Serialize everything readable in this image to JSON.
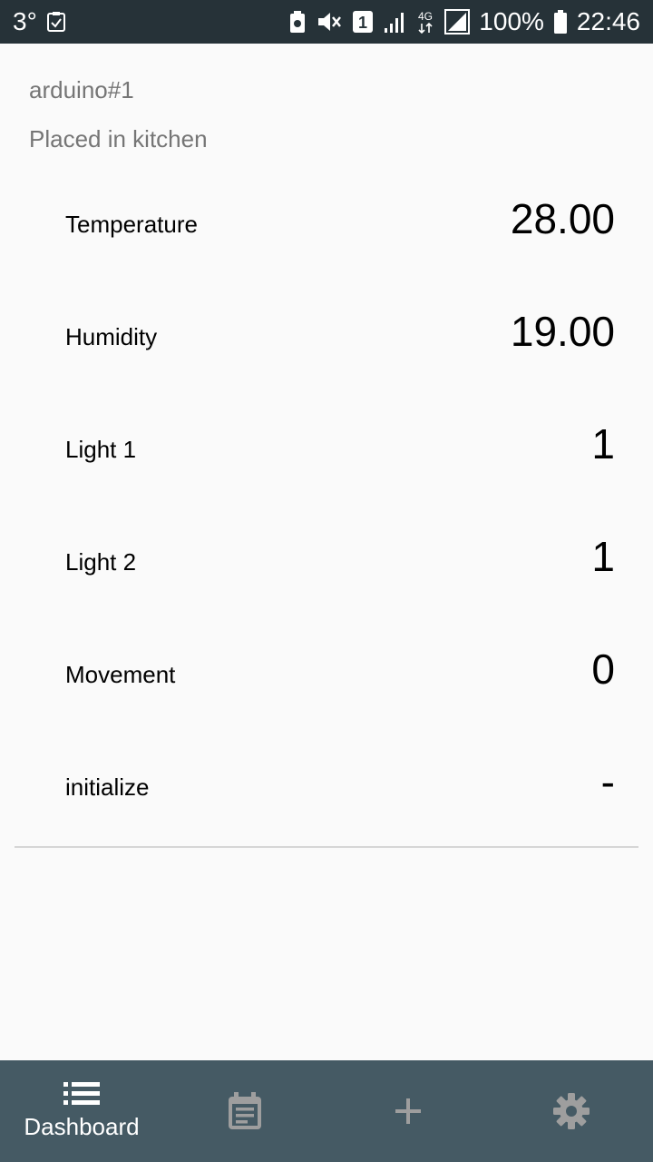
{
  "status_bar": {
    "notification_count": "3°",
    "battery_percent": "100%",
    "time": "22:46",
    "network_type": "4G",
    "sim_slot": "1",
    "background_color": "#263238"
  },
  "device": {
    "name": "arduino#1",
    "location": "Placed in kitchen"
  },
  "sensors": [
    {
      "label": "Temperature",
      "value": "28.00"
    },
    {
      "label": "Humidity",
      "value": "19.00"
    },
    {
      "label": "Light 1",
      "value": "1"
    },
    {
      "label": "Light 2",
      "value": "1"
    },
    {
      "label": "Movement",
      "value": "0"
    },
    {
      "label": "initialize",
      "value": "-"
    }
  ],
  "bottom_nav": {
    "background_color": "#455a64",
    "items": [
      {
        "icon": "list-icon",
        "label": "Dashboard",
        "active": true
      },
      {
        "icon": "calendar-note-icon",
        "label": "",
        "active": false
      },
      {
        "icon": "plus-icon",
        "label": "",
        "active": false
      },
      {
        "icon": "gear-icon",
        "label": "",
        "active": false
      }
    ]
  }
}
